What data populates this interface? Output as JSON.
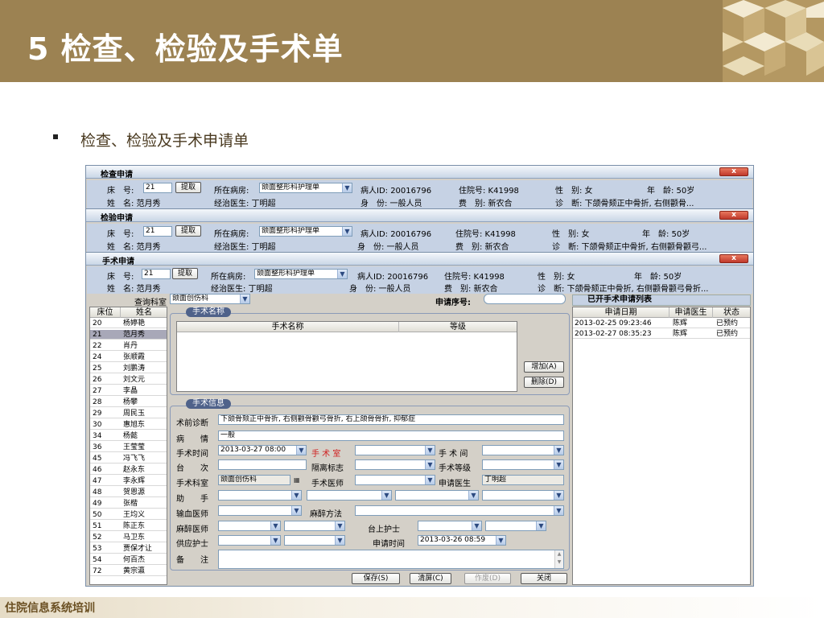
{
  "slide": {
    "title": "5 检查、检验及手术单",
    "subtitle": "检查、检验及手术申请单",
    "footer": "住院信息系统培训"
  },
  "win1": {
    "title": "检查申请",
    "close": "x",
    "bed_label": "床　号:",
    "bed": "21",
    "fetch": "提取",
    "ward_label": "所在病房:",
    "ward": "颌面整形科护理单",
    "pid": "病人ID: 20016796",
    "inno": "住院号: K41998",
    "sex": "性　别: 女",
    "age": "年　龄: 50岁",
    "name": "姓　名: 范月秀",
    "doctor": "经治医生: 丁明超",
    "identity": "身　份: 一般人员",
    "fee": "费　别: 新农合",
    "diag": "诊　断: 下颌骨颏正中骨折, 右侧颧骨..."
  },
  "win2": {
    "title": "检验申请",
    "close": "x",
    "bed_label": "床　号:",
    "bed": "21",
    "fetch": "提取",
    "ward_label": "所在病房:",
    "ward": "颌面整形科护理单",
    "pid": "病人ID: 20016796",
    "inno": "住院号: K41998",
    "sex": "性　别: 女",
    "age": "年　龄: 50岁",
    "name": "姓　名: 范月秀",
    "doctor": "经治医生: 丁明超",
    "identity": "身　份: 一般人员",
    "fee": "费　别: 新农合",
    "diag": "诊　断: 下颌骨颏正中骨折, 右侧颧骨颧弓..."
  },
  "win3": {
    "title": "手术申请",
    "close": "x",
    "bed_label": "床　号:",
    "bed": "21",
    "fetch": "提取",
    "ward_label": "所在病房:",
    "ward": "颌面整形科护理单",
    "pid": "病人ID: 20016796",
    "inno": "住院号: K41998",
    "sex": "性　别: 女",
    "age": "年　龄: 50岁",
    "name": "姓　名: 范月秀",
    "doctor": "经治医生: 丁明超",
    "identity": "身　份: 一般人员",
    "fee": "费　别: 新农合",
    "diag": "诊　断: 下颌骨颏正中骨折, 右侧颧骨颧弓骨折..."
  },
  "query": {
    "dept_label": "查询科室",
    "dept": "颌面创伤科",
    "serial_label": "申请序号:",
    "list_title": "已开手术申请列表"
  },
  "patients": {
    "h_bed": "床位",
    "h_name": "姓名",
    "rows": [
      [
        "20",
        "杨婷艳"
      ],
      [
        "21",
        "范月秀"
      ],
      [
        "22",
        "肖丹"
      ],
      [
        "24",
        "张顺霞"
      ],
      [
        "25",
        "刘鹏涛"
      ],
      [
        "26",
        "刘文元"
      ],
      [
        "27",
        "李晶"
      ],
      [
        "28",
        "杨攀"
      ],
      [
        "29",
        "周民玉"
      ],
      [
        "30",
        "惠旭东"
      ],
      [
        "34",
        "杨懿"
      ],
      [
        "36",
        "王莹莹"
      ],
      [
        "45",
        "冯飞飞"
      ],
      [
        "46",
        "赵永东"
      ],
      [
        "47",
        "李永辉"
      ],
      [
        "48",
        "贺恩源"
      ],
      [
        "49",
        "张楷"
      ],
      [
        "50",
        "王均义"
      ],
      [
        "51",
        "陈正东"
      ],
      [
        "52",
        "马卫东"
      ],
      [
        "53",
        "贾保才让"
      ],
      [
        "54",
        "何百杰"
      ],
      [
        "72",
        "黄宗瀛"
      ]
    ]
  },
  "surgery_name": {
    "group": "手术名称",
    "h_name": "手术名称",
    "h_level": "等级",
    "add": "增加(A)",
    "del": "删除(D)"
  },
  "info": {
    "group": "手术信息",
    "pre_diag_label": "术前诊断",
    "pre_diag": "下颌骨颏正中骨折, 右侧颧骨颧弓骨折, 右上颌骨骨折, 抑郁症",
    "cond_label": "病　　情",
    "cond": "一般",
    "time_label": "手术时间",
    "time": "2013-03-27 08:00",
    "room_label": "手 术 室",
    "between_label": "手 术 间",
    "seat_label": "台　　次",
    "iso_label": "隔离标志",
    "level_label": "手术等级",
    "dept_label": "手术科室",
    "dept": "颌面创伤科",
    "surgeon_label": "手术医师",
    "req_doc_label": "申请医生",
    "req_doc": "丁明超",
    "assist_label": "助　　手",
    "transfuse_label": "输血医师",
    "anes_method_label": "麻醉方法",
    "anes_doc_label": "麻醉医师",
    "nurse_label": "台上护士",
    "supply_label": "供应护士",
    "req_time_label": "申请时间",
    "req_time": "2013-03-26 08:59",
    "note_label": "备　　注"
  },
  "buttons": {
    "save": "保存(S)",
    "clear": "清屏(C)",
    "cancel": "作废(D)",
    "close": "关闭"
  },
  "list": {
    "h_date": "申请日期",
    "h_doc": "申请医生",
    "h_status": "状态",
    "rows": [
      [
        "2013-02-25 09:23:46",
        "陈辉",
        "已预约"
      ],
      [
        "2013-02-27 08:35:23",
        "陈辉",
        "已预约"
      ]
    ]
  }
}
